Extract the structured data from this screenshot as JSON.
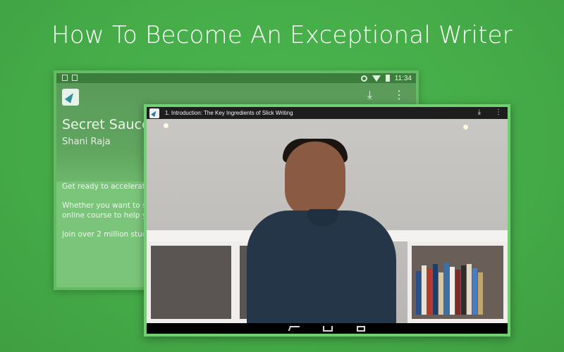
{
  "headline": "How To Become An Exceptional Writer",
  "back_screen": {
    "status_time": "11:34",
    "course_title": "Secret Sauce",
    "author": "Shani Raja",
    "description_lines": [
      "Get ready to accelerate your",
      "Whether you want to start a",
      "online course to help you ge",
      "Join over 2 million students"
    ],
    "download_icon": "download-icon",
    "menu_icon": "more-vert-icon"
  },
  "front_screen": {
    "lesson_title": "1. Introduction: The Key Ingredients of Slick Writing",
    "download_icon": "download-icon",
    "menu_icon": "more-vert-icon",
    "video": "instructor-video-frame",
    "nav": [
      "back-icon",
      "home-icon",
      "recent-apps-icon"
    ]
  },
  "colors": {
    "background": "#45ac48",
    "tablet_border_front": "#6fd16f",
    "tablet_border_back": "#63bb63"
  }
}
